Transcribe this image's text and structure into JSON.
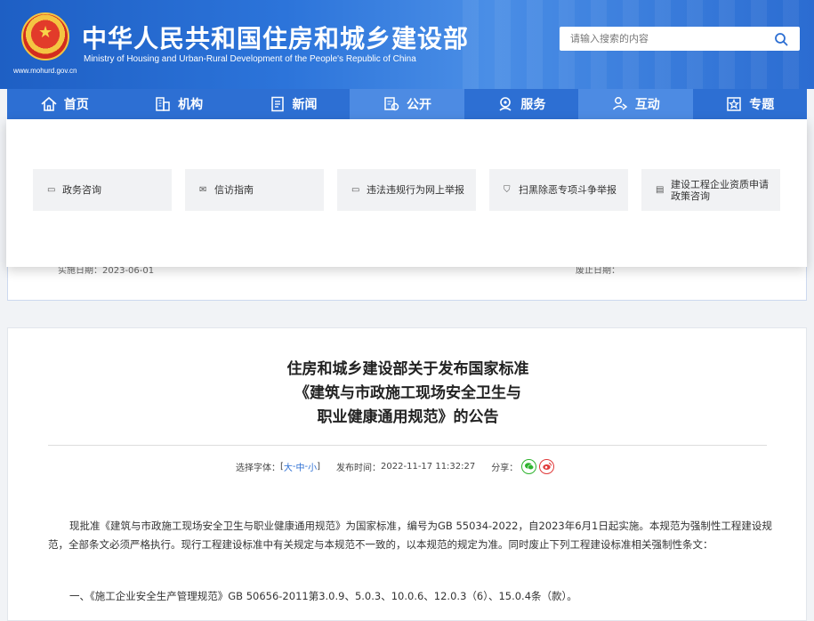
{
  "header": {
    "title": "中华人民共和国住房和城乡建设部",
    "subtitle": "Ministry of Housing and Urban-Rural Development of the People's Republic of China",
    "url": "www.mohurd.gov.cn",
    "brand_color": "#2d6fd3"
  },
  "search": {
    "placeholder": "请输入搜索的内容"
  },
  "nav": {
    "items": [
      {
        "label": "首页",
        "icon": "home-icon"
      },
      {
        "label": "机构",
        "icon": "building-icon"
      },
      {
        "label": "新闻",
        "icon": "news-icon"
      },
      {
        "label": "公开",
        "icon": "open-icon"
      },
      {
        "label": "服务",
        "icon": "service-icon"
      },
      {
        "label": "互动",
        "icon": "interact-icon"
      },
      {
        "label": "专题",
        "icon": "topic-icon"
      }
    ]
  },
  "dropdown": {
    "cards": [
      {
        "label": "政务咨询",
        "icon": "chat-icon"
      },
      {
        "label": "信访指南",
        "icon": "mail-icon"
      },
      {
        "label": "违法违规行为网上举报",
        "icon": "monitor-icon"
      },
      {
        "label": "扫黑除恶专项斗争举报",
        "icon": "shield-icon"
      },
      {
        "label": "建设工程企业资质申请政策咨询",
        "icon": "document-icon"
      }
    ]
  },
  "infobox": {
    "left": "实施日期：2023-06-01",
    "right": "废止日期："
  },
  "article": {
    "title_line1": "住房和城乡建设部关于发布国家标准",
    "title_line2": "《建筑与市政施工现场安全卫生与",
    "title_line3": "职业健康通用规范》的公告",
    "font_label": "选择字体：",
    "font_open": "[",
    "font_large": "大",
    "font_sep1": " - ",
    "font_medium": "中",
    "font_sep2": " - ",
    "font_small": "小",
    "font_close": "]",
    "publish_label": "发布时间：",
    "publish_time": "2022-11-17 11:32:27",
    "share_label": "分享：",
    "paragraph": "现批准《建筑与市政施工现场安全卫生与职业健康通用规范》为国家标准，编号为GB 55034-2022，自2023年6月1日起实施。本规范为强制性工程建设规范，全部条文必须严格执行。现行工程建设标准中有关规定与本规范不一致的，以本规范的规定为准。同时废止下列工程建设标准相关强制性条文：",
    "item1": "一、《施工企业安全生产管理规范》GB 50656-2011第3.0.9、5.0.3、10.0.6、12.0.3（6）、15.0.4条（款）。"
  }
}
